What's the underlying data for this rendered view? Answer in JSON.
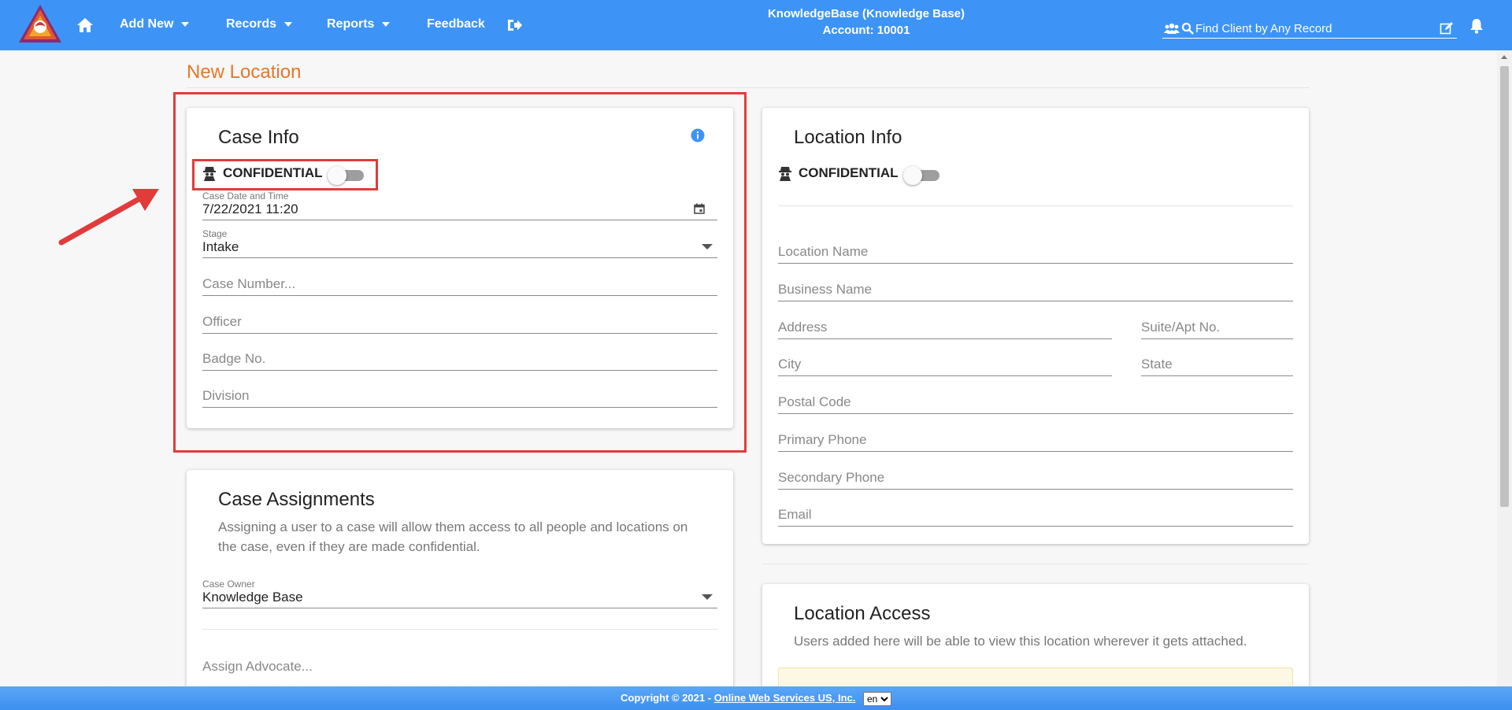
{
  "nav": {
    "home_icon": "home-icon",
    "items": [
      {
        "label": "Add New"
      },
      {
        "label": "Records"
      },
      {
        "label": "Reports"
      },
      {
        "label": "Feedback"
      }
    ],
    "logout_icon": "sign-out-icon",
    "center_line1": "KnowledgeBase (Knowledge Base)",
    "center_line2": "Account: 10001",
    "search_placeholder": "Find Client by Any Record",
    "brand_color": "#3d94f6"
  },
  "page": {
    "title": "New Location",
    "title_color": "#e5772a"
  },
  "case_info": {
    "title": "Case Info",
    "confidential_label": "CONFIDENTIAL",
    "confidential_on": false,
    "date_label": "Case Date and Time",
    "date_value": "7/22/2021 11:20",
    "stage_label": "Stage",
    "stage_value": "Intake",
    "case_number_placeholder": "Case Number...",
    "officer_placeholder": "Officer",
    "badge_placeholder": "Badge No.",
    "division_placeholder": "Division"
  },
  "case_assignments": {
    "title": "Case Assignments",
    "description": "Assigning a user to a case will allow them access to all people and locations on the case, even if they are made confidential.",
    "owner_label": "Case Owner",
    "owner_value": "Knowledge Base",
    "advocate_placeholder": "Assign Advocate..."
  },
  "location_info": {
    "title": "Location Info",
    "confidential_label": "CONFIDENTIAL",
    "confidential_on": false,
    "location_name": "Location Name",
    "business_name": "Business Name",
    "address": "Address",
    "suite": "Suite/Apt No.",
    "city": "City",
    "state": "State",
    "postal": "Postal Code",
    "primary_phone": "Primary Phone",
    "secondary_phone": "Secondary Phone",
    "email": "Email"
  },
  "location_access": {
    "title": "Location Access",
    "description": "Users added here will be able to view this location wherever it gets attached."
  },
  "footer": {
    "copyright": "Copyright © 2021 - ",
    "company": "Online Web Services US, Inc.",
    "language": "en"
  },
  "annotation_color": "#e23b3b"
}
